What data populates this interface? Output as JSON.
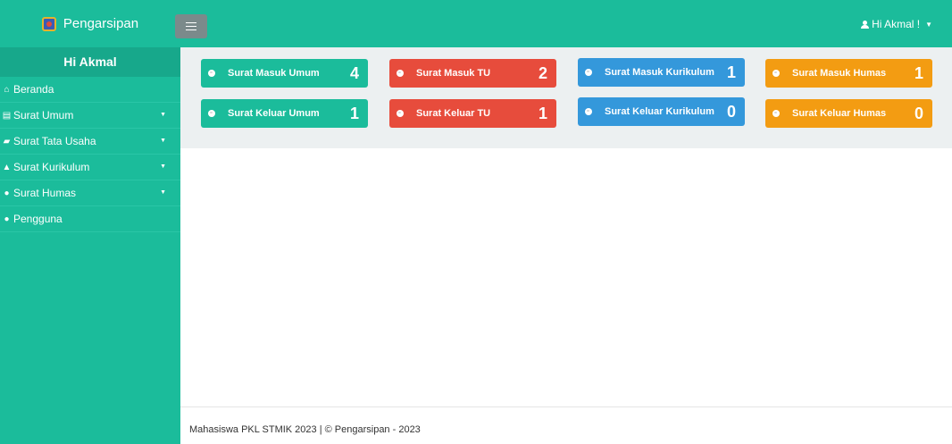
{
  "brand": {
    "title": "Pengarsipan"
  },
  "navbar": {
    "user_label": "Hi Akmal !"
  },
  "sidebar": {
    "header": "Hi Akmal",
    "items": [
      {
        "label": "Beranda",
        "icon": "home-icon",
        "has_submenu": false
      },
      {
        "label": "Surat Umum",
        "icon": "newspaper-icon",
        "has_submenu": true
      },
      {
        "label": "Surat Tata Usaha",
        "icon": "book-icon",
        "has_submenu": true
      },
      {
        "label": "Surat Kurikulum",
        "icon": "graduation-cap-icon",
        "has_submenu": true
      },
      {
        "label": "Surat Humas",
        "icon": "users-icon",
        "has_submenu": true
      },
      {
        "label": "Pengguna",
        "icon": "user-icon",
        "has_submenu": false
      }
    ]
  },
  "tiles": [
    {
      "label": "Surat Masuk Umum",
      "count": "4",
      "color": "#1bbc9b"
    },
    {
      "label": "Surat Masuk TU",
      "count": "2",
      "color": "#e74c3c"
    },
    {
      "label": "Surat Masuk Kurikulum",
      "count": "1",
      "color": "#3498db"
    },
    {
      "label": "Surat Masuk Humas",
      "count": "1",
      "color": "#f39c12"
    },
    {
      "label": "Surat Keluar Umum",
      "count": "1",
      "color": "#1bbc9b"
    },
    {
      "label": "Surat Keluar TU",
      "count": "1",
      "color": "#e74c3c"
    },
    {
      "label": "Surat Keluar Kurikulum",
      "count": "0",
      "color": "#3498db"
    },
    {
      "label": "Surat Keluar Humas",
      "count": "0",
      "color": "#f39c12"
    }
  ],
  "footer": {
    "text": "Mahasiswa PKL STMIK 2023 | © Pengarsipan - 2023"
  }
}
